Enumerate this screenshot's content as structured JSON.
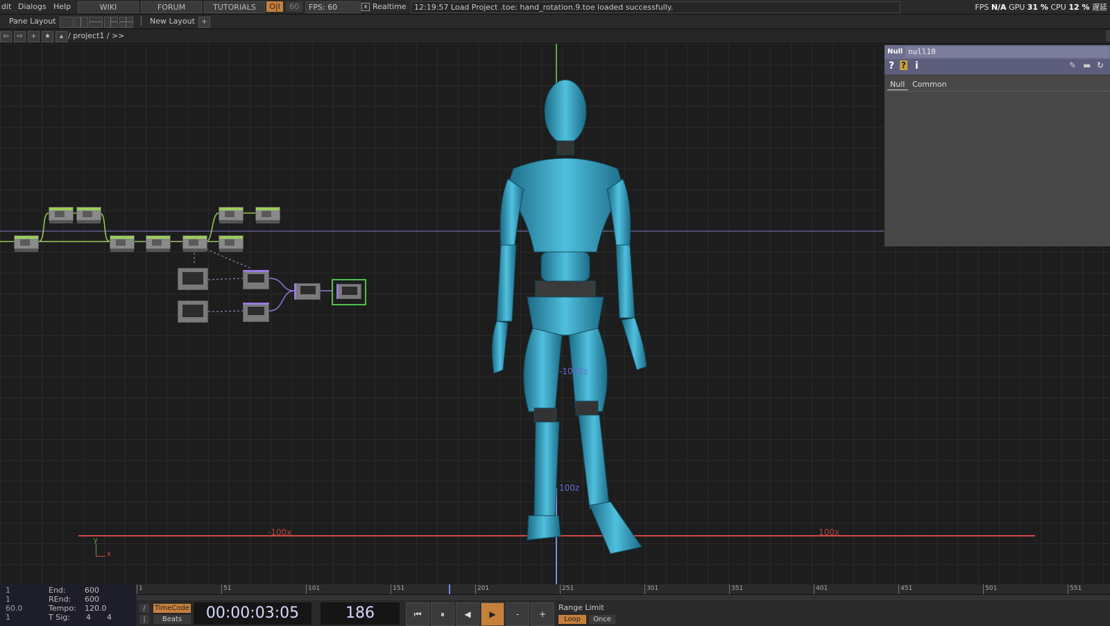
{
  "menu": {
    "items": [
      "dit",
      "Dialogs",
      "Help"
    ],
    "wiki": "WIKI",
    "forum": "FORUM",
    "tutorials": "TUTORIALS",
    "oi": "O|I",
    "fps_value_dim": "60",
    "fps_label": "FPS:  60",
    "realtime_check": "x",
    "realtime_label": "Realtime",
    "status_message": "12:19:57 Load Project .toe: hand_rotation.9.toe loaded successfully.",
    "perf": {
      "fps_label": "FPS",
      "fps_value": "N/A",
      "gpu_label": "GPU",
      "gpu_value": "31 %",
      "cpu_label": "CPU",
      "cpu_value": "12 %",
      "extra": "遅延"
    }
  },
  "pane_bar": {
    "pane_layout_label": "Pane Layout",
    "new_layout_label": "New Layout",
    "add_label": "+"
  },
  "path_bar": {
    "path": "/ project1 / >>"
  },
  "viewport": {
    "axis_labels": {
      "neg_x": "-100x",
      "pos_x": "100x",
      "neg_z": "-1000z",
      "z": "100z",
      "gizmo_x": "x",
      "gizmo_y": "y"
    }
  },
  "params": {
    "op_type": "Null",
    "op_name": "null10",
    "tabs": [
      "Null",
      "Common"
    ]
  },
  "timeline": {
    "range": {
      "start_label_a": "1",
      "start_label_b": "1",
      "rate": "60.0",
      "tsig_left": "1",
      "end_label": "End:",
      "end_value": "600",
      "rend_label": "REnd:",
      "rend_value": "600",
      "tempo_label": "Tempo:",
      "tempo_value": "120.0",
      "tsig_label": "T Sig:",
      "tsig_a": "4",
      "tsig_b": "4"
    },
    "ruler_ticks": [
      "1",
      "51",
      "101",
      "151",
      "201",
      "251",
      "301",
      "351",
      "401",
      "451",
      "501",
      "551"
    ],
    "timecode_label": "TimeCode",
    "beats_label": "Beats",
    "timecode": "00:00:03:05",
    "frame": "186",
    "range_limit_label": "Range Limit",
    "loop_label": "Loop",
    "once_label": "Once",
    "minus_label": "-",
    "plus_label": "+"
  },
  "colors": {
    "accent_orange": "#c7803a",
    "node_green": "#9ccc5a",
    "robot_cyan": "#3aa6c6",
    "axis_red": "#d04848",
    "axis_green": "#5aa84a",
    "param_header": "#6e6e8e"
  }
}
